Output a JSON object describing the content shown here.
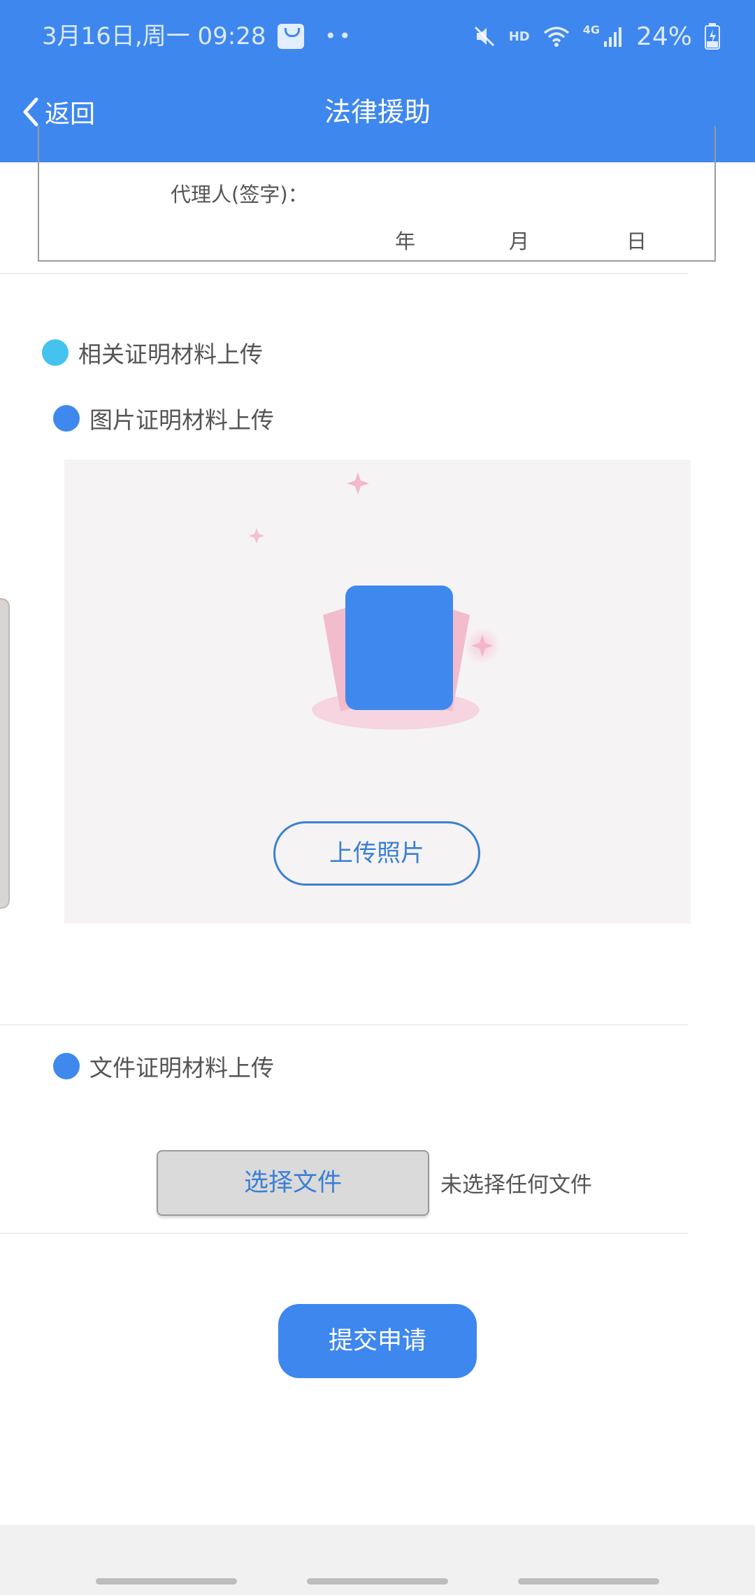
{
  "status_bar": {
    "datetime": "3月16日,周一  09:28",
    "dots": "••",
    "hd": "HD",
    "network": "4G",
    "battery": "24%",
    "icons": [
      "shopping-bag-icon",
      "mute-icon",
      "wifi-icon",
      "signal-icon",
      "battery-charging-icon"
    ]
  },
  "header": {
    "back_label": "返回",
    "title": "法律援助"
  },
  "signature": {
    "agent_label": "代理人(签字)：",
    "year": "年",
    "month": "月",
    "day": "日"
  },
  "sections": {
    "related_materials": "相关证明材料上传",
    "image_materials": "图片证明材料上传",
    "file_materials": "文件证明材料上传"
  },
  "upload": {
    "upload_photo_label": "上传照片"
  },
  "file_input": {
    "choose_label": "选择文件",
    "no_file_text": "未选择任何文件"
  },
  "actions": {
    "submit_label": "提交申请"
  },
  "colors": {
    "primary": "#3e87ee",
    "accent_dot": "#43c3ee",
    "link_blue": "#3a7fd4"
  }
}
